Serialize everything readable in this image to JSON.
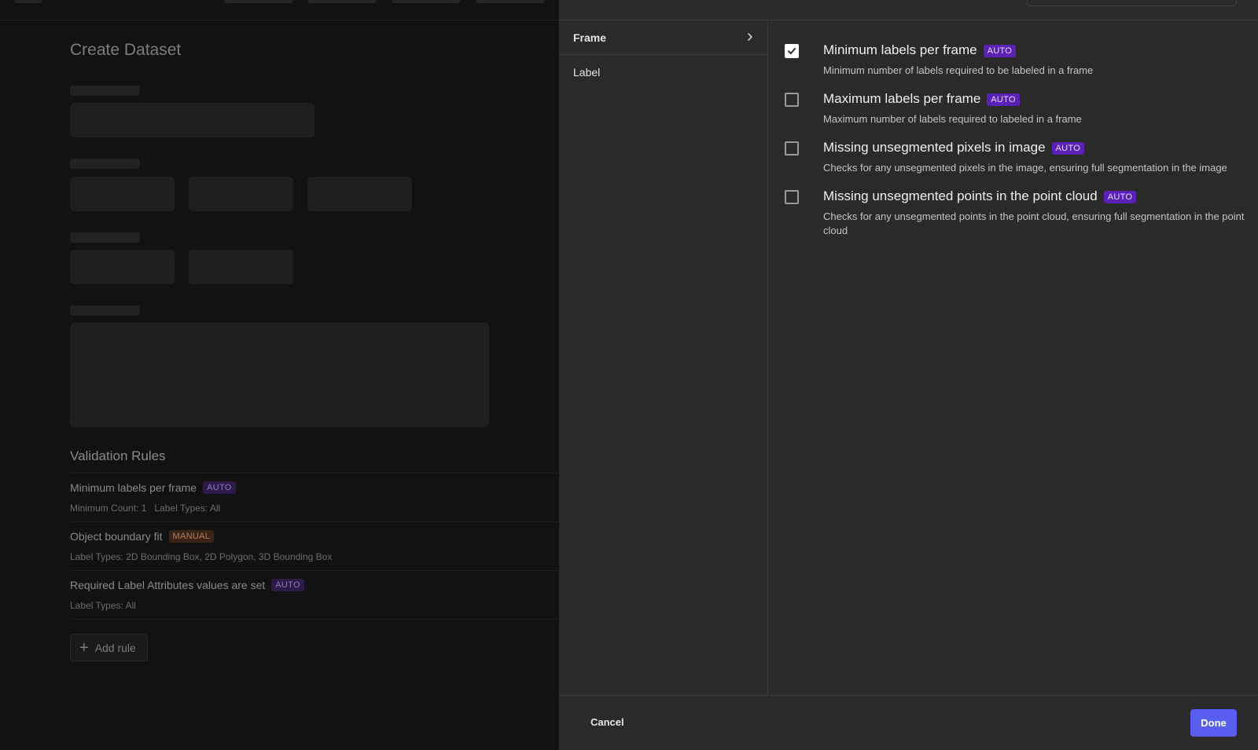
{
  "background_page": {
    "title": "Create Dataset",
    "validation_rules": {
      "title": "Validation Rules",
      "rules": [
        {
          "name": "Minimum labels per frame",
          "badge": "AUTO",
          "details": "Minimum Count: 1   Label Types: All"
        },
        {
          "name": "Object boundary fit",
          "badge": "MANUAL",
          "details": "Label Types: 2D Bounding Box, 2D Polygon, 3D Bounding Box"
        },
        {
          "name": "Required Label Attributes values are set",
          "badge": "AUTO",
          "details": "Label Types: All"
        }
      ],
      "add_rule_label": "Add rule"
    }
  },
  "modal": {
    "categories": [
      {
        "label": "Frame",
        "active": true
      },
      {
        "label": "Label",
        "active": false
      }
    ],
    "options": [
      {
        "title": "Minimum labels per frame",
        "badge": "AUTO",
        "description": "Minimum number of labels required to be labeled in a frame",
        "checked": true
      },
      {
        "title": "Maximum labels per frame",
        "badge": "AUTO",
        "description": "Maximum number of labels required to labeled in a frame",
        "checked": false
      },
      {
        "title": "Missing unsegmented pixels in image",
        "badge": "AUTO",
        "description": "Checks for any unsegmented pixels in the image, ensuring full segmentation in the image",
        "checked": false
      },
      {
        "title": "Missing unsegmented points in the point cloud",
        "badge": "AUTO",
        "description": "Checks for any unsegmented points in the point cloud, ensuring full segmentation in the point cloud",
        "checked": false
      }
    ],
    "footer": {
      "cancel_label": "Cancel",
      "done_label": "Done"
    }
  },
  "colors": {
    "accent": "#5a5ef0",
    "auto_badge": "#5b21b6",
    "manual_badge": "#3a2418"
  }
}
